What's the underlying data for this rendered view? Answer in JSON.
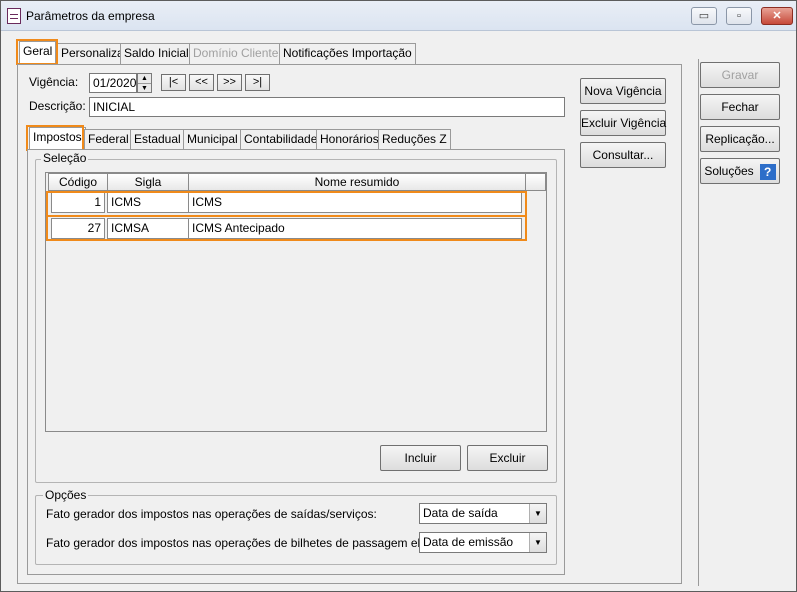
{
  "window": {
    "title": "Parâmetros da empresa",
    "minimize_glyph": "▭",
    "maximize_glyph": "▫",
    "close_glyph": "✕"
  },
  "main_tabs": [
    "Geral",
    "Personaliza",
    "Saldo Inicial",
    "Domínio Cliente",
    "Notificações Importação"
  ],
  "vigencia": {
    "label": "Vigência:",
    "value": "01/2020",
    "nav": [
      "|<",
      "<<",
      ">>",
      ">|"
    ]
  },
  "descricao": {
    "label": "Descrição:",
    "value": "INICIAL"
  },
  "side_buttons": {
    "nova_vigencia": "Nova Vigência",
    "excluir_vigencia": "Excluir Vigência",
    "consultar": "Consultar..."
  },
  "right_buttons": {
    "gravar": "Gravar",
    "fechar": "Fechar",
    "replicacao": "Replicação...",
    "solucoes": "Soluções"
  },
  "sub_tabs": [
    "Impostos",
    "Federal",
    "Estadual",
    "Municipal",
    "Contabilidade",
    "Honorários",
    "Reduções Z"
  ],
  "selecao": {
    "label": "Seleção",
    "columns": [
      "Código",
      "Sigla",
      "Nome resumido"
    ],
    "rows": [
      {
        "codigo": "1",
        "sigla": "ICMS",
        "nome": "ICMS"
      },
      {
        "codigo": "27",
        "sigla": "ICMSA",
        "nome": "ICMS Antecipado"
      }
    ],
    "incluir": "Incluir",
    "excluir": "Excluir"
  },
  "opcoes": {
    "label": "Opções",
    "fato_saidas_label": "Fato gerador dos impostos nas operações de saídas/serviços:",
    "fato_saidas_value": "Data de saída",
    "fato_bilhetes_label": "Fato gerador dos impostos nas operações de bilhetes de passagem eletrônico:",
    "fato_bilhetes_value": "Data de emissão"
  },
  "colors": {
    "highlight": "#f08a1a",
    "help_icon": "#2d6ec9"
  }
}
